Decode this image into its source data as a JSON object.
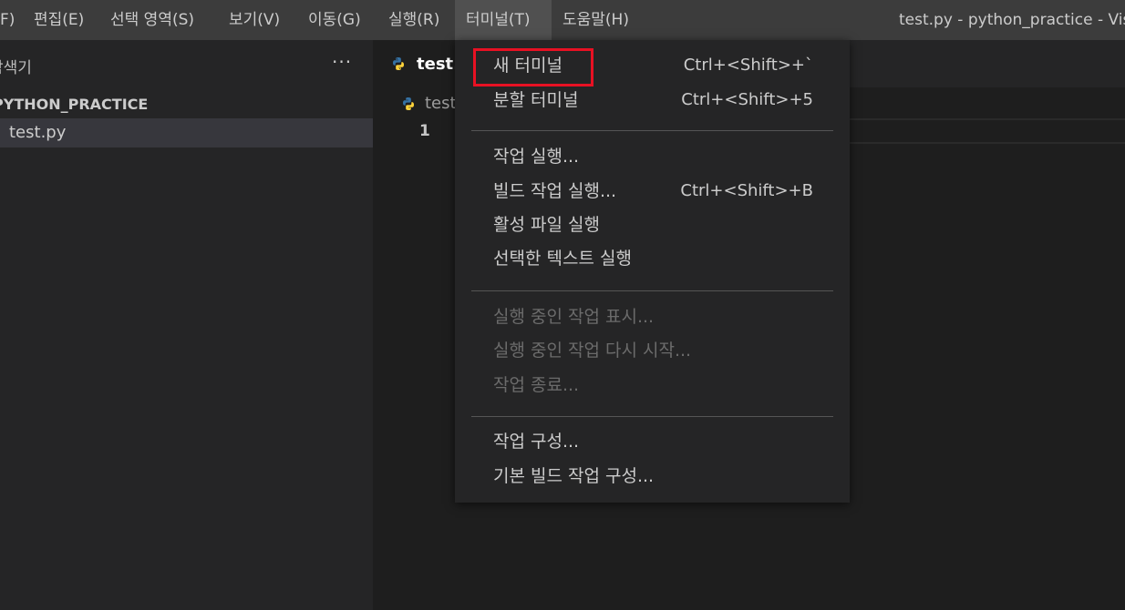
{
  "menubar": {
    "items": [
      "F)",
      "편집(E)",
      "선택 영역(S)",
      "보기(V)",
      "이동(G)",
      "실행(R)",
      "터미널(T)",
      "도움말(H)"
    ],
    "window_title": "test.py - python_practice - Visua"
  },
  "sidebar": {
    "title": "탐색기",
    "more_icon": "···",
    "folder": "PYTHON_PRACTICE",
    "file": "test.py"
  },
  "editor": {
    "tab_label": "test.p",
    "breadcrumb_label": "test",
    "line_number": "1"
  },
  "terminal_menu": {
    "items": [
      {
        "label": "새 터미널",
        "shortcut": "Ctrl+<Shift>+`"
      },
      {
        "label": "분할 터미널",
        "shortcut": "Ctrl+<Shift>+5"
      },
      {
        "label": "작업 실행...",
        "shortcut": ""
      },
      {
        "label": "빌드 작업 실행...",
        "shortcut": "Ctrl+<Shift>+B"
      },
      {
        "label": "활성 파일 실행",
        "shortcut": ""
      },
      {
        "label": "선택한 텍스트 실행",
        "shortcut": ""
      },
      {
        "label": "실행 중인 작업 표시...",
        "shortcut": ""
      },
      {
        "label": "실행 중인 작업 다시 시작...",
        "shortcut": ""
      },
      {
        "label": "작업 종료...",
        "shortcut": ""
      },
      {
        "label": "작업 구성...",
        "shortcut": ""
      },
      {
        "label": "기본 빌드 작업 구성...",
        "shortcut": ""
      }
    ]
  },
  "colors": {
    "highlight_border": "#e81123",
    "python_blue": "#3572a5",
    "python_yellow": "#ffd43b"
  }
}
